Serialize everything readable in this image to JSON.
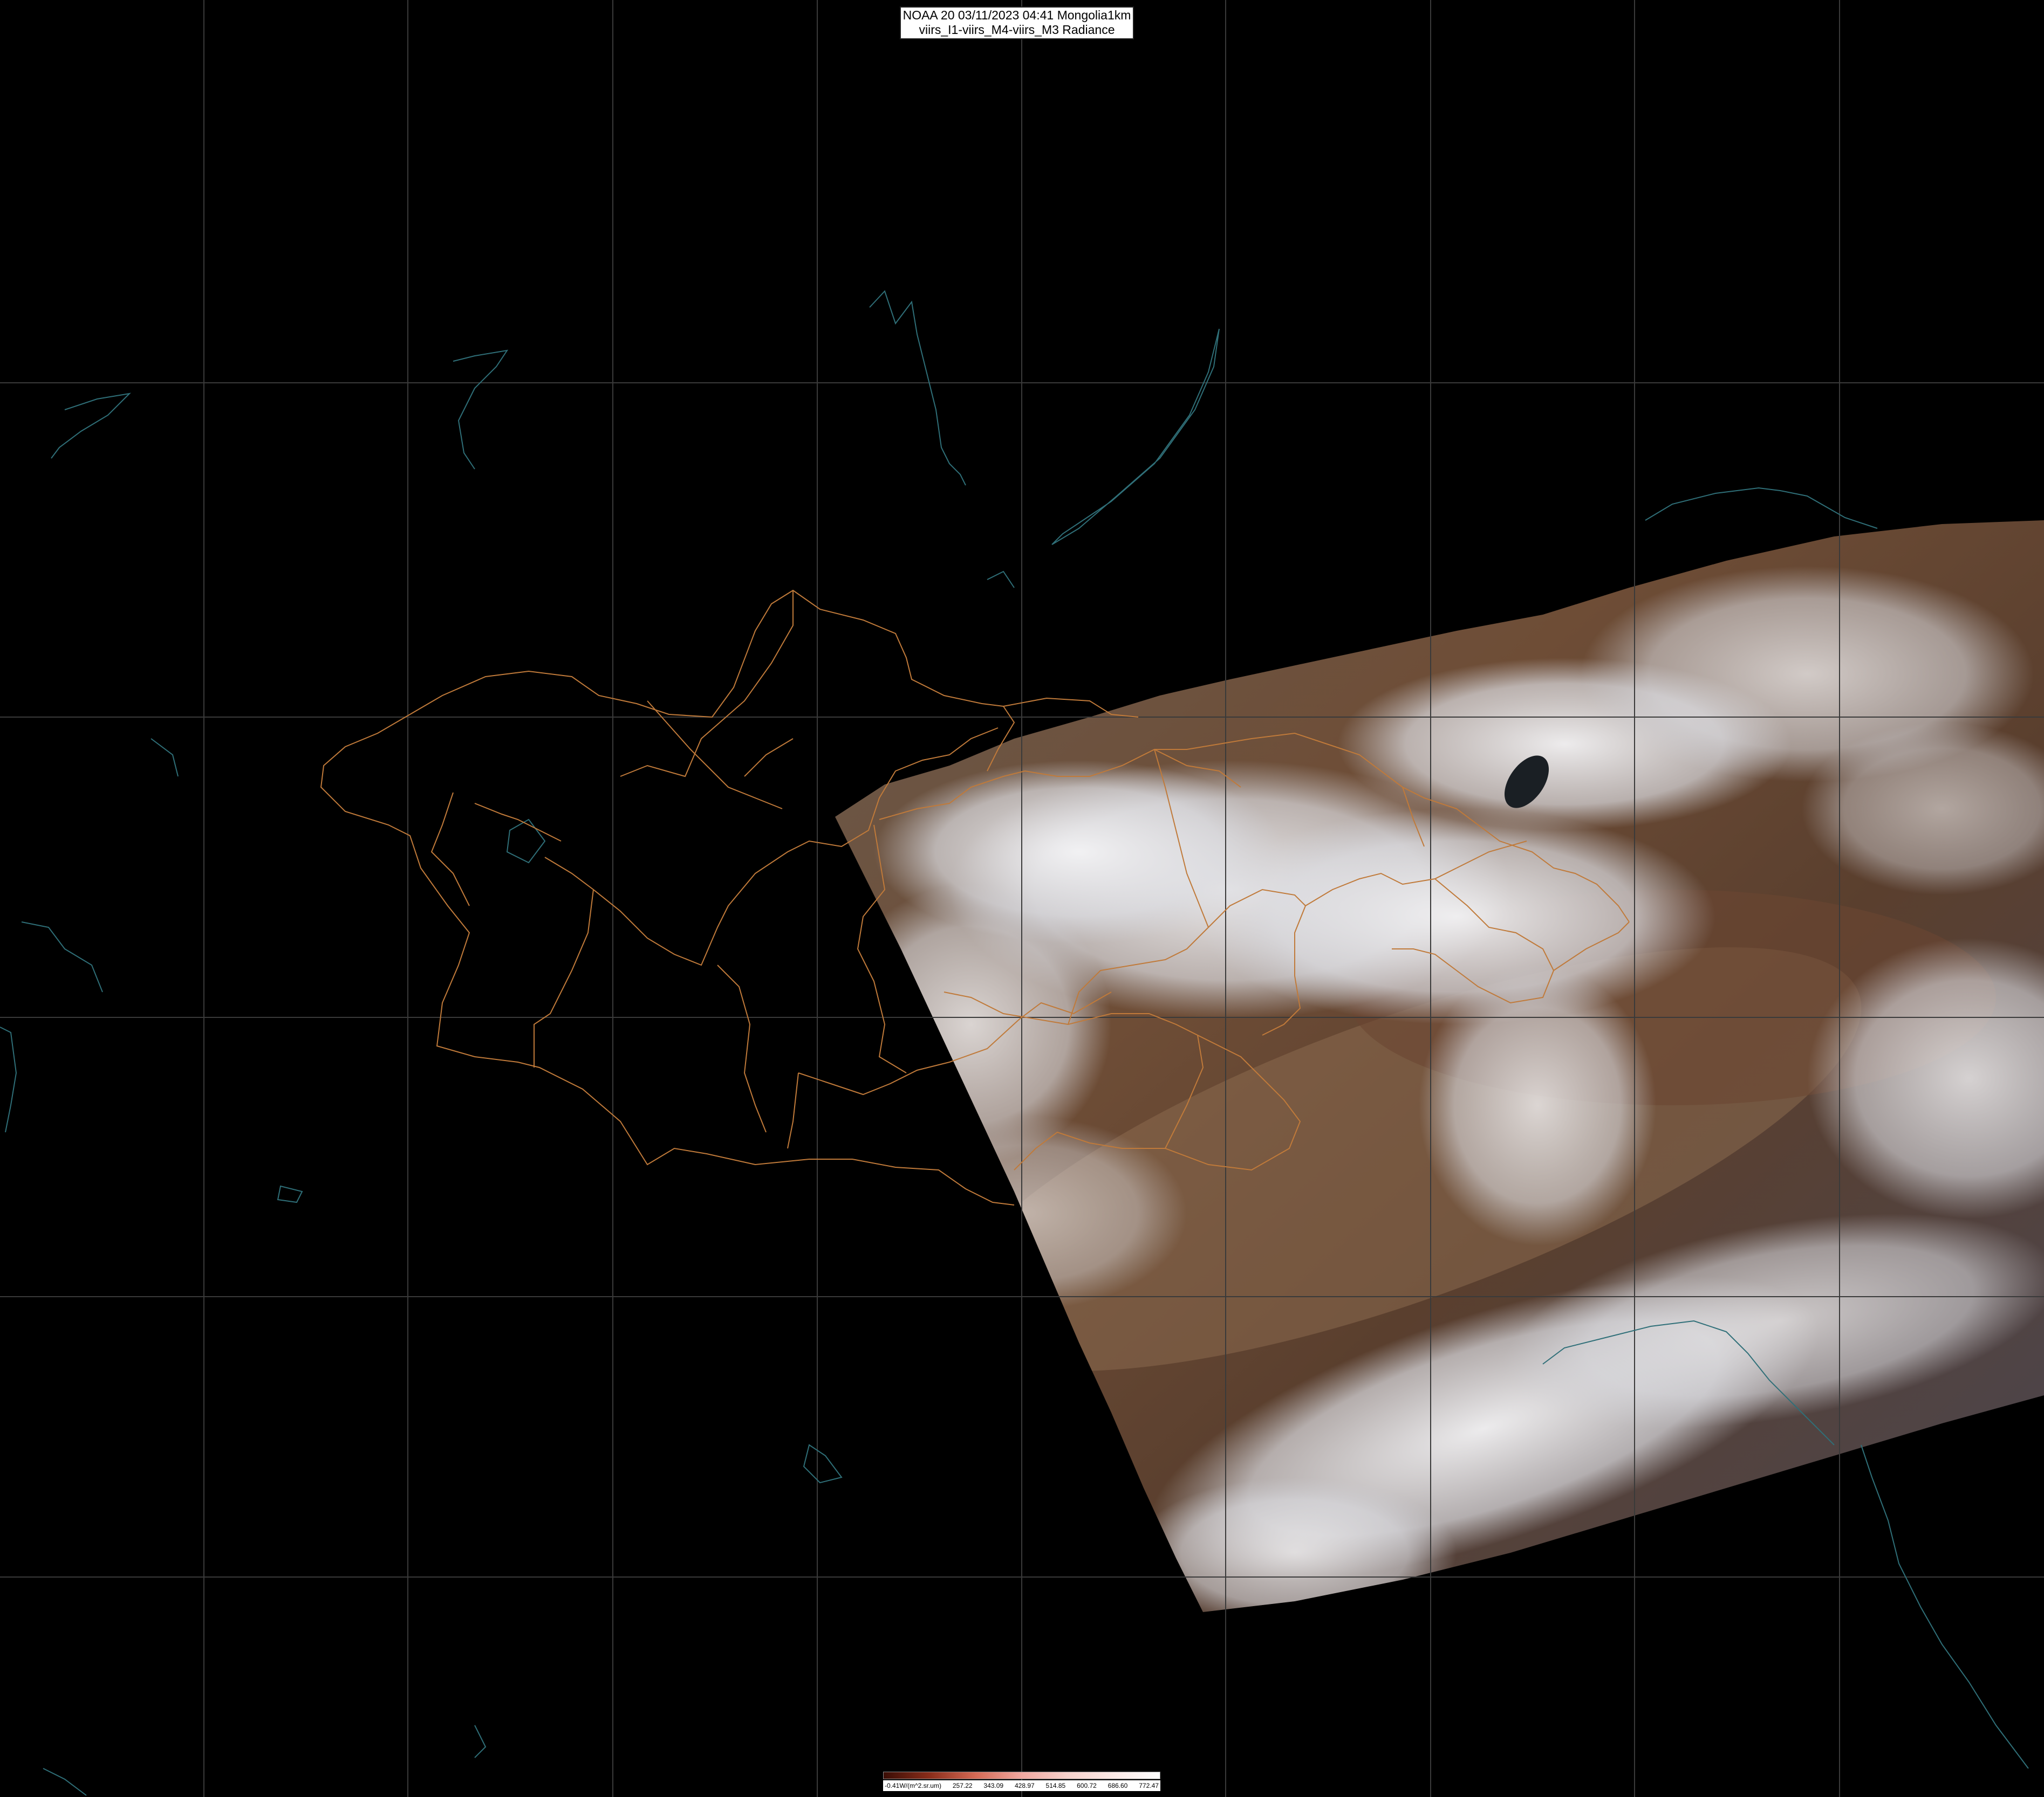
{
  "title": {
    "line1": "NOAA 20 03/11/2023 04:41 Mongolia1km",
    "line2": "viirs_I1-viirs_M4-viirs_M3 Radiance"
  },
  "legend": {
    "labels": [
      "-0.41W/(m^2.sr.um)",
      "257.22",
      "343.09",
      "428.97",
      "514.85",
      "600.72",
      "686.60",
      "772.47"
    ],
    "colors": [
      "#3a0d05",
      "#8a2d1a",
      "#d46a55",
      "#f0a8a0",
      "#f6d2cc",
      "#fbe9e6",
      "#ffffff"
    ]
  },
  "colors": {
    "background": "#000000",
    "graticule": "#3a3a3a",
    "borders": "#c07a3a",
    "coastline": "#2f6f78"
  }
}
